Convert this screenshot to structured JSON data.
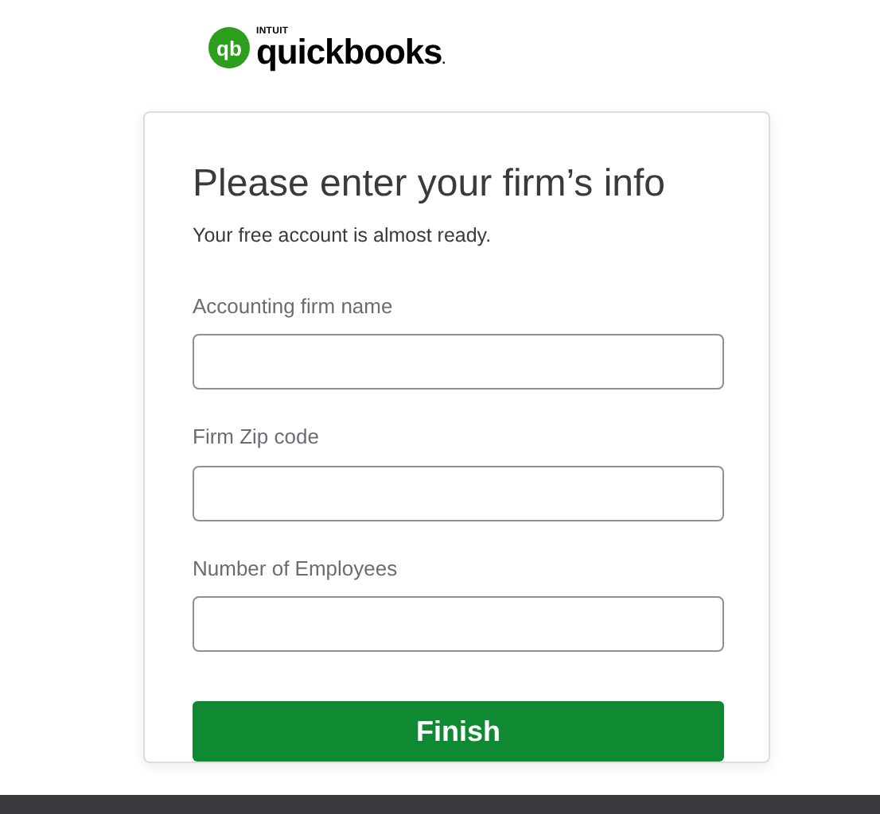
{
  "logo": {
    "mark": "qb",
    "company": "INTUIT",
    "product": "quickbooks",
    "dot": "."
  },
  "form": {
    "title": "Please enter your firm’s info",
    "subtitle": "Your free account is almost ready.",
    "fields": [
      {
        "label": "Accounting firm name"
      },
      {
        "label": "Firm Zip code"
      },
      {
        "label": "Number of Employees"
      }
    ],
    "submit": "Finish"
  }
}
